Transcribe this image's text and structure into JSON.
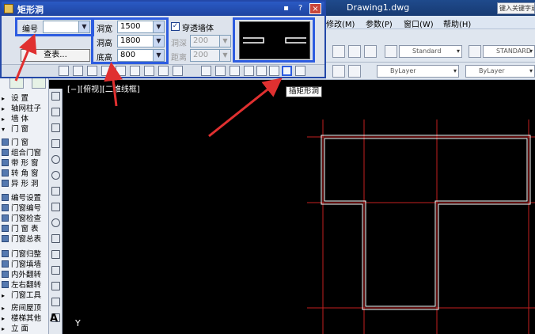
{
  "app": {
    "title": "Drawing1.dwg",
    "search_placeholder": "键入关键字或短语"
  },
  "menubar": {
    "items": [
      "修改(M)",
      "参数(P)",
      "窗口(W)",
      "帮助(H)"
    ]
  },
  "toolbar": {
    "text_style": "Standard",
    "dim_style": "STANDARD",
    "layer_color": "ByLayer",
    "linetype": "ByLayer"
  },
  "viewport": {
    "label": "[−][俯视][二维线框]"
  },
  "dialog": {
    "title": "矩形洞",
    "number_label": "编号",
    "number_value": "",
    "query_button": "查表...",
    "width_label": "洞宽",
    "width_value": "1500",
    "height_label": "洞高",
    "height_value": "1800",
    "sill_label": "底高",
    "sill_value": "800",
    "through_wall_label": "穿透墙体",
    "depth_label": "洞深",
    "depth_value": "200",
    "distance_label": "距离",
    "distance_value": "200",
    "title_buttons": {
      "pin": "▪",
      "help": "?",
      "close": "×"
    }
  },
  "tooltip": "插矩形洞",
  "palette": {
    "items": [
      "设  置",
      "轴网柱子",
      "墙  体",
      "门  窗",
      "门  窗",
      "组合门窗",
      "带 形 窗",
      "转 角 窗",
      "异 形 洞",
      "编号设置",
      "门窗编号",
      "门窗检查",
      "门 窗 表",
      "门窗总表",
      "门窗归整",
      "门窗填墙",
      "内外翻转",
      "左右翻转",
      "门窗工具",
      "房间屋顶",
      "楼梯其他",
      "立  面"
    ]
  },
  "ucs": {
    "y_label": "Y"
  },
  "colors": {
    "accent": "#2d5ce0",
    "grid_line": "#c42020",
    "wall": "#ffffff",
    "arrow": "#e03030"
  }
}
